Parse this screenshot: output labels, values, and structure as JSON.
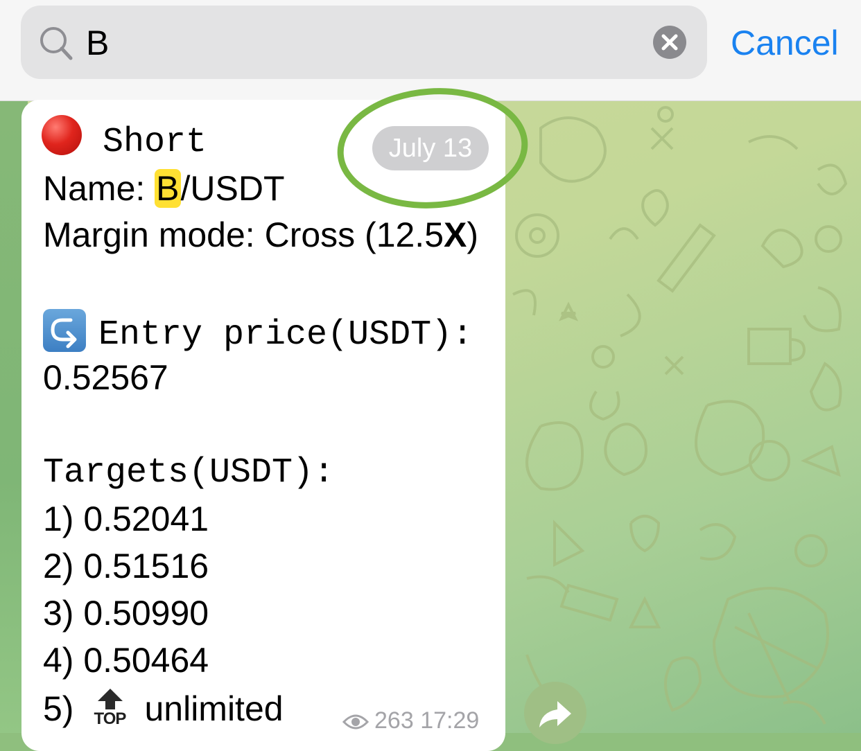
{
  "search": {
    "value": "B",
    "cancel_label": "Cancel"
  },
  "message": {
    "direction": "Short",
    "name_label": "Name: ",
    "name_highlight": "B",
    "name_rest": "/USDT",
    "margin_prefix": "Margin mode: Cross (12.5",
    "margin_x": "X",
    "margin_suffix": ")",
    "entry_label": "Entry price(USDT):",
    "entry_value": "0.52567",
    "targets_label": "Targets(USDT):",
    "targets": [
      "1) 0.52041",
      "2) 0.51516",
      "3) 0.50990",
      "4) 0.50464"
    ],
    "target5_prefix": "5)",
    "target5_icon_text": "TOP",
    "target5_value": "unlimited",
    "views": "263",
    "time": "17:29"
  },
  "date_pill": "July 13",
  "colors": {
    "accent": "#1a82f0",
    "highlight": "#ffe033",
    "annotation_ring": "#79b843"
  },
  "icons": [
    "search-icon",
    "clear-icon",
    "red-circle-icon",
    "entry-arrow-icon",
    "top-arrow-icon",
    "eye-icon",
    "forward-icon"
  ]
}
